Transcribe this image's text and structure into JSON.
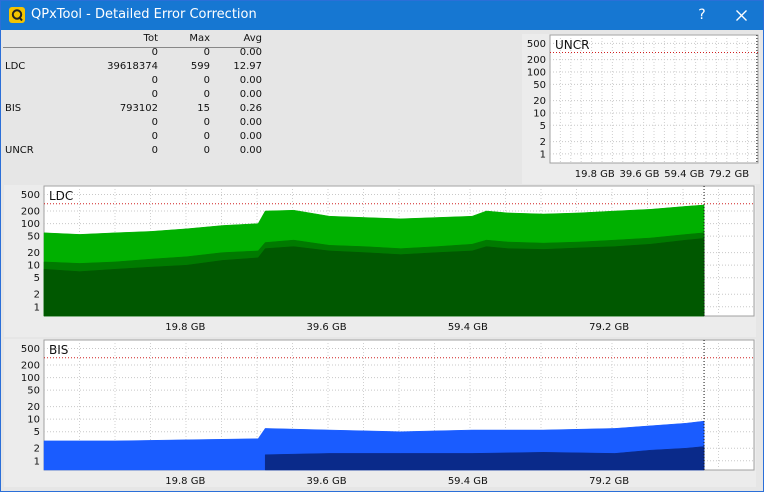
{
  "window": {
    "title": "QPxTool - Detailed Error Correction",
    "help_label": "?",
    "accent": "#1677d2"
  },
  "stats": {
    "headers": [
      "Tot",
      "Max",
      "Avg"
    ],
    "rows": [
      {
        "label": "",
        "tot": "0",
        "max": "0",
        "avg": "0.00"
      },
      {
        "label": "LDC",
        "tot": "39618374",
        "max": "599",
        "avg": "12.97"
      },
      {
        "label": "",
        "tot": "0",
        "max": "0",
        "avg": "0.00"
      },
      {
        "label": "",
        "tot": "0",
        "max": "0",
        "avg": "0.00"
      },
      {
        "label": "BIS",
        "tot": "793102",
        "max": "15",
        "avg": "0.26"
      },
      {
        "label": "",
        "tot": "0",
        "max": "0",
        "avg": "0.00"
      },
      {
        "label": "",
        "tot": "0",
        "max": "0",
        "avg": "0.00"
      },
      {
        "label": "UNCR",
        "tot": "0",
        "max": "0",
        "avg": "0.00"
      }
    ]
  },
  "chart_data": [
    {
      "type": "area",
      "title": "UNCR",
      "scale": "log",
      "y_ticks": [
        "500",
        "200",
        "100",
        "50",
        "20",
        "10",
        "5",
        "2",
        "1"
      ],
      "y_tick_values": [
        500,
        200,
        100,
        50,
        20,
        10,
        5,
        2,
        1
      ],
      "x_ticks": [
        "19.8 GB",
        "39.6 GB",
        "59.4 GB",
        "79.2 GB"
      ],
      "x_tick_values": [
        19.8,
        39.6,
        59.4,
        79.2
      ],
      "x_range": [
        0,
        92
      ],
      "y_range": [
        0.6,
        800
      ],
      "threshold": 300,
      "end_marker": 91.5,
      "grid": true,
      "series": []
    },
    {
      "type": "area",
      "title": "LDC",
      "scale": "log",
      "y_ticks": [
        "500",
        "200",
        "100",
        "50",
        "20",
        "10",
        "5",
        "2",
        "1"
      ],
      "y_tick_values": [
        500,
        200,
        100,
        50,
        20,
        10,
        5,
        2,
        1
      ],
      "x_ticks": [
        "19.8 GB",
        "39.6 GB",
        "59.4 GB",
        "79.2 GB"
      ],
      "x_tick_values": [
        19.8,
        39.6,
        59.4,
        79.2
      ],
      "x_range": [
        0,
        99.5
      ],
      "y_range": [
        0.6,
        800
      ],
      "threshold": 300,
      "end_marker": 92.5,
      "grid": true,
      "series": [
        {
          "color": "#00b000",
          "x": [
            0,
            5,
            10,
            15,
            20,
            25,
            30,
            31,
            35,
            40,
            45,
            50,
            55,
            60,
            62,
            65,
            70,
            75,
            80,
            85,
            90,
            92.5
          ],
          "values": [
            60,
            55,
            60,
            65,
            75,
            90,
            100,
            200,
            210,
            150,
            140,
            130,
            140,
            150,
            200,
            180,
            170,
            180,
            200,
            220,
            260,
            280
          ]
        },
        {
          "color": "#007a00",
          "x": [
            0,
            5,
            10,
            15,
            20,
            25,
            30,
            31,
            35,
            40,
            45,
            50,
            55,
            60,
            62,
            65,
            70,
            75,
            80,
            85,
            90,
            92.5
          ],
          "values": [
            12,
            11,
            12,
            14,
            16,
            20,
            22,
            35,
            40,
            30,
            28,
            25,
            28,
            32,
            40,
            36,
            34,
            36,
            40,
            45,
            55,
            60
          ]
        },
        {
          "color": "#005800",
          "x": [
            0,
            5,
            10,
            15,
            20,
            25,
            30,
            31,
            35,
            40,
            45,
            50,
            55,
            60,
            62,
            65,
            70,
            75,
            80,
            85,
            90,
            92.5
          ],
          "values": [
            8,
            7,
            8,
            9,
            10,
            13,
            15,
            25,
            28,
            22,
            20,
            18,
            20,
            22,
            28,
            25,
            24,
            26,
            28,
            32,
            40,
            44
          ]
        }
      ]
    },
    {
      "type": "area",
      "title": "BIS",
      "scale": "log",
      "y_ticks": [
        "500",
        "200",
        "100",
        "50",
        "20",
        "10",
        "5",
        "2",
        "1"
      ],
      "y_tick_values": [
        500,
        200,
        100,
        50,
        20,
        10,
        5,
        2,
        1
      ],
      "x_ticks": [
        "19.8 GB",
        "39.6 GB",
        "59.4 GB",
        "79.2 GB"
      ],
      "x_tick_values": [
        19.8,
        39.6,
        59.4,
        79.2
      ],
      "x_range": [
        0,
        99.5
      ],
      "y_range": [
        0.6,
        800
      ],
      "threshold": 300,
      "end_marker": 92.5,
      "grid": true,
      "series": [
        {
          "color": "#1a5cff",
          "x": [
            0,
            10,
            20,
            30,
            31,
            40,
            50,
            60,
            70,
            80,
            90,
            92.5
          ],
          "values": [
            3,
            3,
            3.2,
            3.4,
            6,
            5.5,
            5,
            5.5,
            5.5,
            6,
            8,
            9
          ]
        },
        {
          "color": "#0a2a8a",
          "x": [
            31,
            40,
            50,
            60,
            70,
            80,
            85,
            90,
            92.5
          ],
          "values": [
            1.4,
            1.5,
            1.5,
            1.5,
            1.6,
            1.5,
            1.8,
            2,
            2.2
          ]
        }
      ]
    }
  ]
}
